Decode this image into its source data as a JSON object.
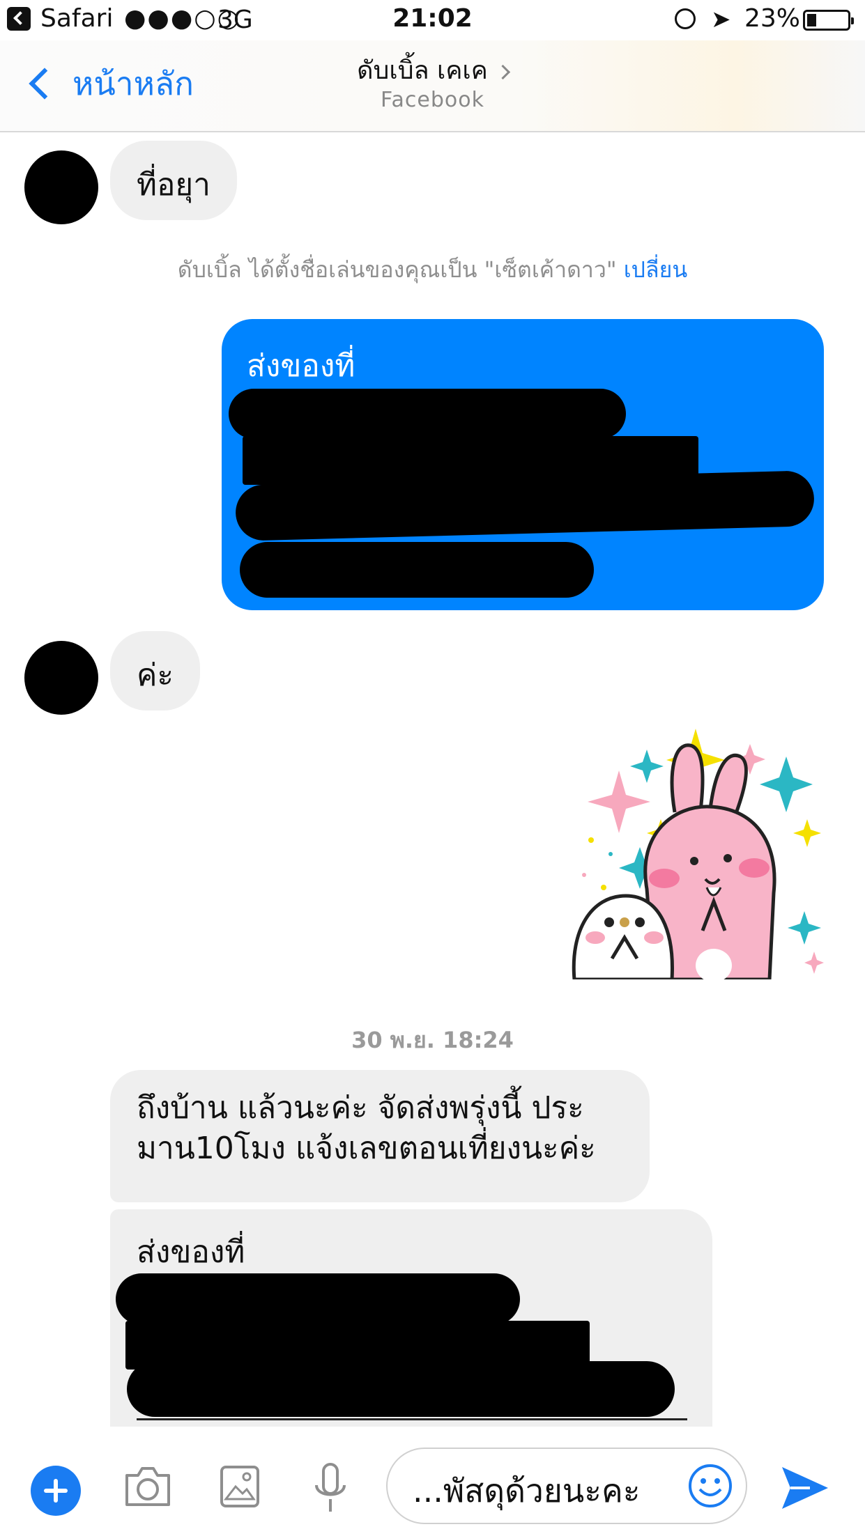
{
  "status": {
    "app_name": "Safari",
    "signal": "●●●○○",
    "network": "3G",
    "time": "21:02",
    "battery_percent": "23%",
    "battery_level": 0.23
  },
  "header": {
    "back_label": "หน้าหลัก",
    "title": "ดับเบิ้ล เคเค",
    "subtitle": "Facebook"
  },
  "messages": {
    "incoming_1": "ที่อยุา",
    "notice_text": "ดับเบิ้ล ได้ตั้งชื่อเล่นของคุณเป็น \"เซ็ตเค้าดาว\" ",
    "notice_link": "เปลี่ยน",
    "outgoing_1_heading": "ส่งของที่",
    "incoming_2": "ค่ะ",
    "timestamp": "30 พ.ย. 18:24",
    "incoming_3_line1": "ถึงบ้าน แล้วนะค่ะ จัดส่งพรุ่งนี้ ประ",
    "incoming_3_line2": "มาน10โมง แจ้งเลขตอนเที่ยงนะค่ะ",
    "incoming_4_heading": "ส่งของที่"
  },
  "composer": {
    "input_text": "...พัสดุด้วยนะคะ"
  },
  "colors": {
    "accent": "#1a7cf2",
    "outgoing_bubble": "#0084ff",
    "incoming_bubble": "#efefef"
  },
  "icons": [
    "plus-icon",
    "camera-icon",
    "photo-icon",
    "microphone-icon",
    "emoji-icon",
    "send-icon"
  ]
}
